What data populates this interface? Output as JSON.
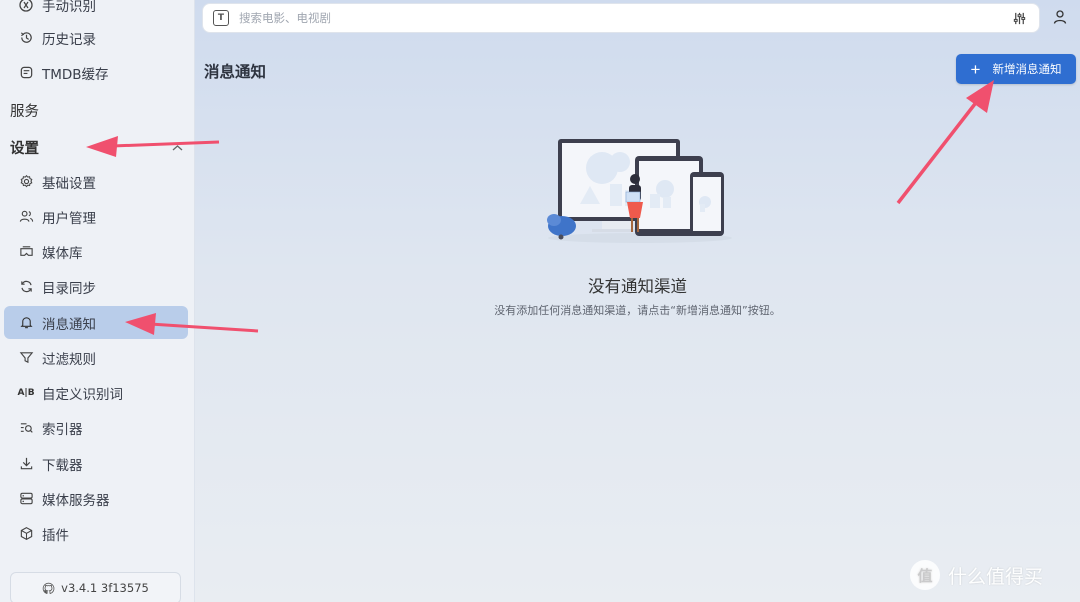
{
  "search": {
    "placeholder": "搜索电影、电视剧",
    "type_icon_letter": "T"
  },
  "sidebar": {
    "top_cut_item": "手动识别",
    "items_top": [
      {
        "label": "历史记录",
        "icon": "history-icon"
      },
      {
        "label": "TMDB缓存",
        "icon": "cache-icon"
      }
    ],
    "section_services": "服务",
    "section_settings": "设置",
    "settings_items": [
      {
        "label": "基础设置",
        "icon": "gear-icon"
      },
      {
        "label": "用户管理",
        "icon": "users-icon"
      },
      {
        "label": "媒体库",
        "icon": "media-library-icon"
      },
      {
        "label": "目录同步",
        "icon": "sync-icon"
      },
      {
        "label": "消息通知",
        "icon": "bell-icon"
      },
      {
        "label": "过滤规则",
        "icon": "filter-icon"
      },
      {
        "label": "自定义识别词",
        "icon": "ab-icon"
      },
      {
        "label": "索引器",
        "icon": "indexer-icon"
      },
      {
        "label": "下载器",
        "icon": "download-icon"
      },
      {
        "label": "媒体服务器",
        "icon": "server-icon"
      },
      {
        "label": "插件",
        "icon": "plugin-icon"
      }
    ],
    "active_item": "消息通知",
    "version": "v3.4.1 3f13575"
  },
  "main": {
    "page_title": "消息通知",
    "add_button_label": "新增消息通知",
    "empty_title": "没有通知渠道",
    "empty_description": "没有添加任何消息通知渠道，请点击“新增消息通知”按钮。"
  },
  "watermark": {
    "text": "什么值得买",
    "logo_char": "值"
  },
  "colors": {
    "accent": "#2f6ed1",
    "active_bg": "#b9cdea",
    "annotation_arrow": "#f0506e"
  }
}
